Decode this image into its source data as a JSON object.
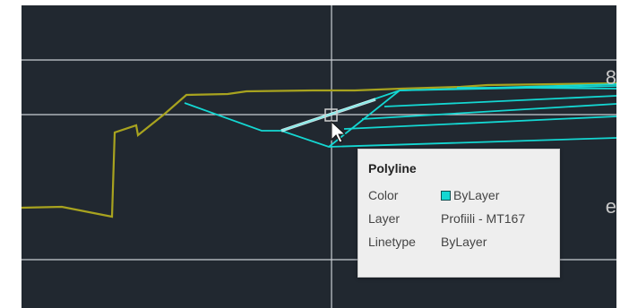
{
  "tooltip": {
    "title": "Polyline",
    "properties": [
      {
        "label": "Color",
        "value": "ByLayer",
        "swatch": "#14d7d2"
      },
      {
        "label": "Layer",
        "value": "Profiili - MT167"
      },
      {
        "label": "Linetype",
        "value": "ByLayer"
      }
    ]
  },
  "colors": {
    "background": "#212830",
    "grid": "#c9ced4",
    "ground_polyline": "#a8a31f",
    "cyan_polyline": "#14d7d2",
    "highlight": "#e6ffff"
  },
  "edge_glyphs": [
    "8",
    "e"
  ],
  "icons": [
    "pick-box-cursor-icon",
    "arrow-pointer-icon"
  ]
}
